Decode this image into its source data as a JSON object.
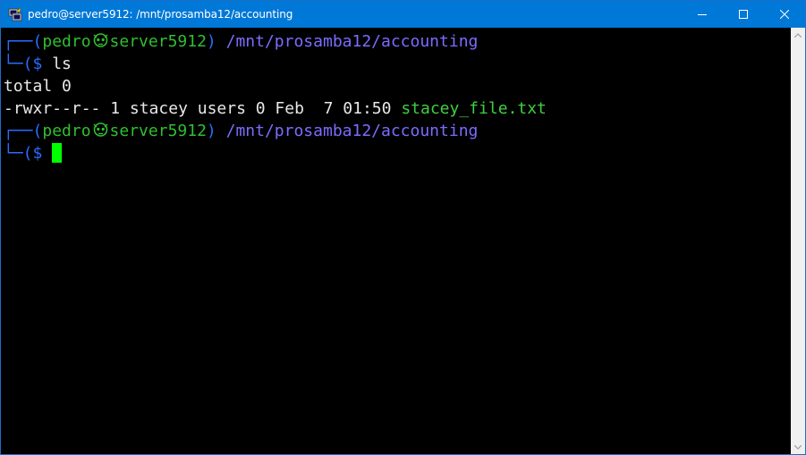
{
  "window": {
    "title": "pedro@server5912: /mnt/prosamba12/accounting",
    "icon": "putty-icon",
    "controls": [
      "minimize-icon",
      "maximize-icon",
      "close-icon"
    ]
  },
  "terminal": {
    "prompt": {
      "corner_top": "┌──(",
      "corner_bottom": "└─(",
      "user": "pedro",
      "separator_icon": "skull-icon",
      "host": "server5912",
      "close_paren": ")",
      "path": "/mnt/prosamba12/accounting",
      "symbol": "$"
    },
    "commands": [
      {
        "text": "ls"
      },
      {
        "text": ""
      }
    ],
    "output": {
      "total": "total 0",
      "listing_meta": "-rwxr--r-- 1 stacey users 0 Feb  7 01:50 ",
      "listing_name": "stacey_file.txt"
    }
  },
  "colors": {
    "titlebar": "#0078d7",
    "prompt_frame": "#2a6cff",
    "user_host": "#2fbf2f",
    "path": "#7b6cff",
    "file": "#3fd03f",
    "cursor": "#00ff00"
  }
}
